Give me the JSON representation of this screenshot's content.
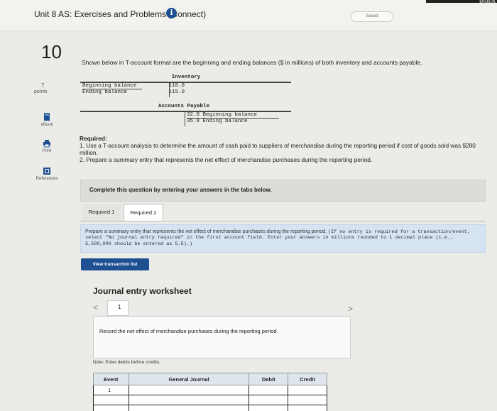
{
  "header": {
    "title": "Unit 8 AS: Exercises and Problems (Connect)",
    "info_icon": "i",
    "saved_label": "Saved",
    "corner_text": "black"
  },
  "sidebar": {
    "question_number": "10",
    "points_value": "7",
    "points_label": "points",
    "items": [
      {
        "label": "eBook",
        "icon": "book-icon"
      },
      {
        "label": "Print",
        "icon": "print-icon"
      },
      {
        "label": "References",
        "icon": "references-icon"
      }
    ]
  },
  "problem": {
    "intro": "Shown below in T-account format are the beginning and ending balances ($ in millions) of both inventory and accounts payable.",
    "inventory": {
      "title": "Inventory",
      "rows": [
        {
          "label": "Beginning balance",
          "value": "110.0"
        },
        {
          "label": "Ending balance",
          "value": "115.0"
        }
      ]
    },
    "accounts_payable": {
      "title": "Accounts Payable",
      "rows": [
        {
          "value": "32.0",
          "label": "Beginning balance"
        },
        {
          "value": "35.8",
          "label": "Ending balance"
        }
      ]
    },
    "required_heading": "Required:",
    "required_1": "1. Use a T-account analysis to determine the amount of cash paid to suppliers of merchandise during the reporting period if cost of goods sold was $280 million.",
    "required_2": "2. Prepare a summary entry that represents the net effect of merchandise purchases during the reporting period."
  },
  "banner": "Complete this question by entering your answers in the tabs below.",
  "tabs": [
    {
      "label": "Required 1",
      "active": false
    },
    {
      "label": "Required 2",
      "active": true
    }
  ],
  "instructions": {
    "main": "Prepare a summary entry that represents the net effect of merchandise purchases during the reporting period.",
    "note": "(If no entry is required for a transaction/event, select \"No journal entry required\" in the first account field. Enter your answers in millions rounded to 1 decimal place (i.e., 5,500,000 should be entered as 5.5).)"
  },
  "view_button": "View transaction list",
  "worksheet": {
    "title": "Journal entry worksheet",
    "page_number": "1",
    "record_text": "Record the net effect of merchandise purchases during the reporting period.",
    "note": "Note: Enter debits before credits.",
    "columns": [
      "Event",
      "General Journal",
      "Debit",
      "Credit"
    ],
    "first_event": "1"
  }
}
